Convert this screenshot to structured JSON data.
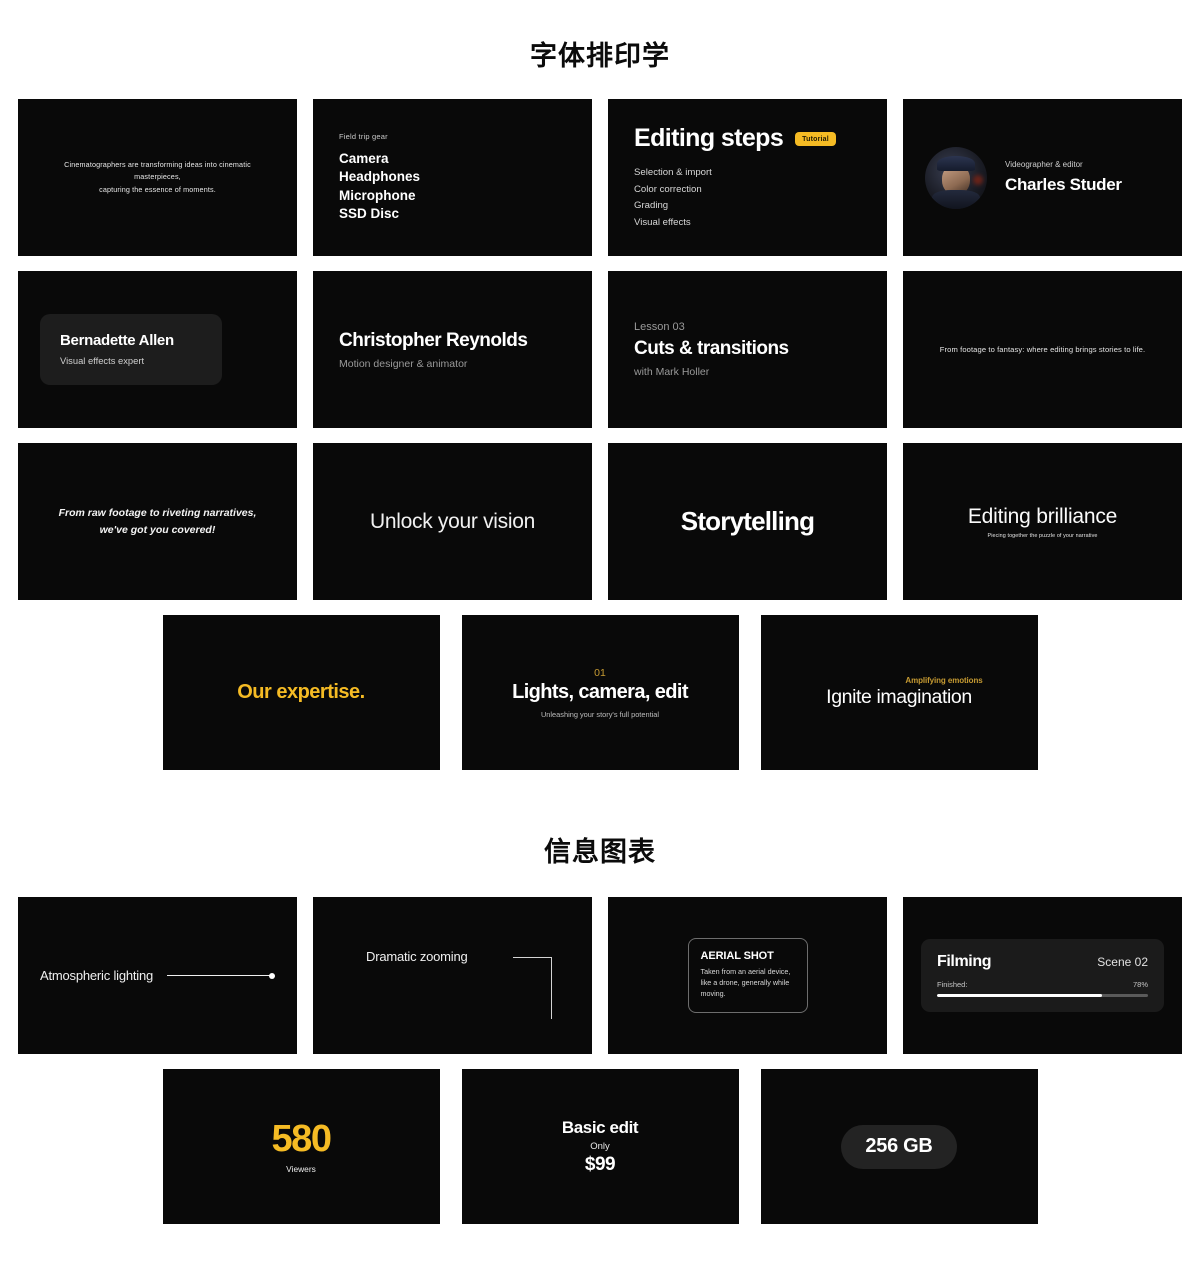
{
  "sections": [
    {
      "title": "字体排印学"
    },
    {
      "title": "信息图表"
    }
  ],
  "colors": {
    "accent_gold": "#f5bb24",
    "accent_gold_dim": "#c79b32",
    "card_bg": "#090909",
    "page_bg": "#ffffff"
  },
  "typography_cards": {
    "quote": {
      "line1": "Cinematographers are transforming ideas into cinematic masterpieces,",
      "line2": "capturing the essence of moments."
    },
    "gear": {
      "eyebrow": "Field trip gear",
      "items": [
        "Camera",
        "Headphones",
        "Microphone",
        "SSD Disc"
      ]
    },
    "steps": {
      "title": "Editing steps",
      "badge": "Tutorial",
      "items": [
        "Selection & import",
        "Color correction",
        "Grading",
        "Visual effects"
      ]
    },
    "person": {
      "role": "Videographer & editor",
      "name": "Charles Studer",
      "avatar_icon": "portrait-avatar"
    },
    "name_box": {
      "name": "Bernadette Allen",
      "role": "Visual effects expert"
    },
    "designer": {
      "name": "Christopher Reynolds",
      "role": "Motion designer & animator"
    },
    "lesson": {
      "eyebrow": "Lesson 03",
      "title": "Cuts & transitions",
      "sub": "with Mark Holler"
    },
    "tagline_small": "From footage to fantasy: where editing brings stories to life.",
    "tagline_italic": {
      "line1": "From raw footage to riveting narratives,",
      "line2": "we've got you covered!"
    },
    "unlock": "Unlock your vision",
    "storytelling": "Storytelling",
    "brilliance": {
      "title": "Editing brilliance",
      "caption": "Piecing together the puzzle of your narrative"
    },
    "expertise": "Our expertise.",
    "lights": {
      "number": "01",
      "title": "Lights, camera, edit",
      "sub": "Unleashing your story's full potential"
    },
    "ignite": {
      "eyebrow": "Amplifying emotions",
      "title": "Ignite imagination"
    }
  },
  "infographic_cards": {
    "atmospheric": {
      "label": "Atmospheric lighting",
      "connector_icon": "line-dot-connector"
    },
    "zooming": {
      "label": "Dramatic zooming",
      "connector_icon": "elbow-connector"
    },
    "aerial": {
      "title": "AERIAL SHOT",
      "description": "Taken from an aerial device, like a drone, generally while moving."
    },
    "filming": {
      "title": "Filming",
      "scene": "Scene 02",
      "meta_label": "Finished:",
      "percent_label": "78%",
      "percent_value": 78
    },
    "stat": {
      "value": "580",
      "label": "Viewers"
    },
    "price": {
      "title": "Basic edit",
      "only": "Only",
      "amount": "$99"
    },
    "storage": {
      "pill": "256 GB"
    }
  }
}
